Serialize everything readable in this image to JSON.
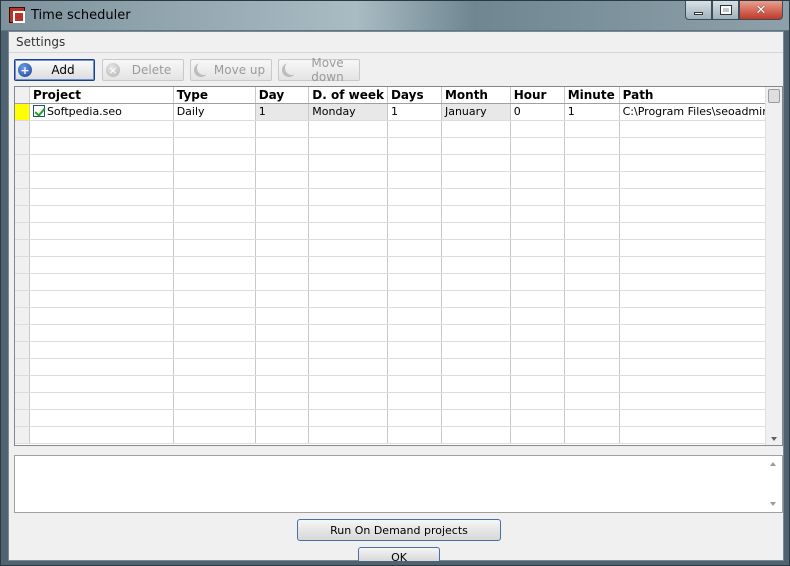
{
  "window": {
    "title": "Time scheduler"
  },
  "menu": {
    "settings": "Settings"
  },
  "toolbar": {
    "add": "Add",
    "delete": "Delete",
    "move_up": "Move up",
    "move_down": "Move down"
  },
  "grid": {
    "columns": [
      "Project",
      "Type",
      "Day",
      "D. of week",
      "Days",
      "Month",
      "Hour",
      "Minute",
      "Path"
    ],
    "rows": [
      {
        "project": "Softpedia.seo",
        "checked": true,
        "type": "Daily",
        "day": "1",
        "dow": "Monday",
        "days": "1",
        "month": "January",
        "hour": "0",
        "minute": "1",
        "path": "C:\\Program Files\\seoadminis"
      }
    ]
  },
  "buttons": {
    "run_on_demand": "Run On Demand projects",
    "ok": "OK"
  }
}
